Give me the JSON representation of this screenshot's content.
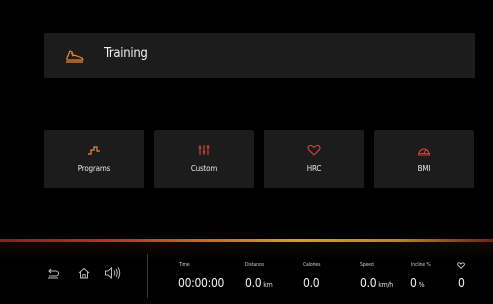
{
  "header": {
    "icon": "running-shoe-icon",
    "title": "Training"
  },
  "tiles": [
    {
      "id": "programs",
      "icon": "terrain-steps-icon",
      "label": "Programs"
    },
    {
      "id": "custom",
      "icon": "sliders-icon",
      "label": "Custom"
    },
    {
      "id": "hrc",
      "icon": "heart-icon",
      "label": "HRC"
    },
    {
      "id": "bmi",
      "icon": "scale-gauge-icon",
      "label": "BMI"
    }
  ],
  "controls": {
    "back_icon": "back-arrow-icon",
    "home_icon": "home-icon",
    "volume_icon": "speaker-icon"
  },
  "stats": {
    "time": {
      "label": "Time",
      "value": "00:00:00",
      "unit": ""
    },
    "distance": {
      "label": "Distance",
      "value": "0.0",
      "unit": "km"
    },
    "calories": {
      "label": "Calories",
      "value": "0.0",
      "unit": ""
    },
    "speed": {
      "label": "Speed",
      "value": "0.0",
      "unit": "km/h"
    },
    "incline": {
      "label": "Incline %",
      "value": "0",
      "unit": "%"
    },
    "heart_rate": {
      "icon": "heart-outline-icon",
      "value": "0"
    }
  },
  "colors": {
    "accent_orange": "#e8893a",
    "accent_red": "#d2493a",
    "tile_bg": "#1c1c1c",
    "background": "#000000"
  }
}
